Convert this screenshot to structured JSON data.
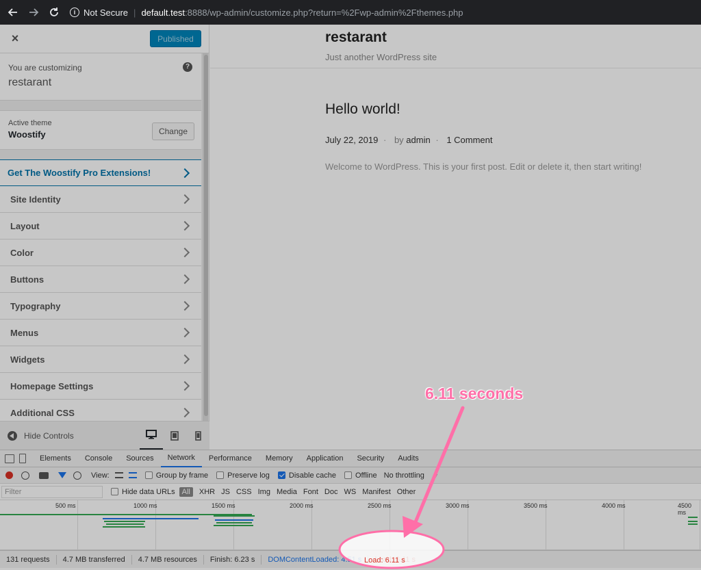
{
  "browser": {
    "not_secure": "Not Secure",
    "separator": "|",
    "url_host": "default.test",
    "url_path": ":8888/wp-admin/customize.php?return=%2Fwp-admin%2Fthemes.php"
  },
  "customizer": {
    "close_label": "×",
    "publish_label": "Published",
    "customizing_label": "You are customizing",
    "site_name": "restarant",
    "help_label": "?",
    "active_theme_label": "Active theme",
    "theme_name": "Woostify",
    "change_label": "Change",
    "pro_item": "Get The Woostify Pro Extensions!",
    "menu_items": [
      "Site Identity",
      "Layout",
      "Color",
      "Buttons",
      "Typography",
      "Menus",
      "Widgets",
      "Homepage Settings",
      "Additional CSS"
    ],
    "hide_controls": "Hide Controls"
  },
  "preview": {
    "site_title": "restarant",
    "site_description": "Just another WordPress site",
    "post_title": "Hello world!",
    "post_date": "July 22, 2019",
    "meta_dot": "·",
    "by_label": "by",
    "author": "admin",
    "comments": "1 Comment",
    "excerpt": "Welcome to WordPress. This is your first post. Edit or delete it, then start writing!"
  },
  "devtools": {
    "tabs": [
      "Elements",
      "Console",
      "Sources",
      "Network",
      "Performance",
      "Memory",
      "Application",
      "Security",
      "Audits"
    ],
    "active_tab": "Network",
    "view_label": "View:",
    "group_by_frame": "Group by frame",
    "preserve_log": "Preserve log",
    "disable_cache": "Disable cache",
    "offline": "Offline",
    "throttling": "No throttling",
    "filter_placeholder": "Filter",
    "hide_data_urls": "Hide data URLs",
    "filter_types": [
      "All",
      "XHR",
      "JS",
      "CSS",
      "Img",
      "Media",
      "Font",
      "Doc",
      "WS",
      "Manifest",
      "Other"
    ],
    "ticks": [
      "500 ms",
      "1000 ms",
      "1500 ms",
      "2000 ms",
      "2500 ms",
      "3000 ms",
      "3500 ms",
      "4000 ms",
      "4500 ms"
    ],
    "status": {
      "requests": "131 requests",
      "transferred": "4.7 MB transferred",
      "resources": "4.7 MB resources",
      "finish": "Finish: 6.23 s",
      "dom_content_loaded": "DOMContentLoaded: 4.51 s",
      "load": "Load: 6.11 s"
    }
  },
  "annotation": {
    "text": "6.11 seconds",
    "color": "#ff6fa8"
  }
}
